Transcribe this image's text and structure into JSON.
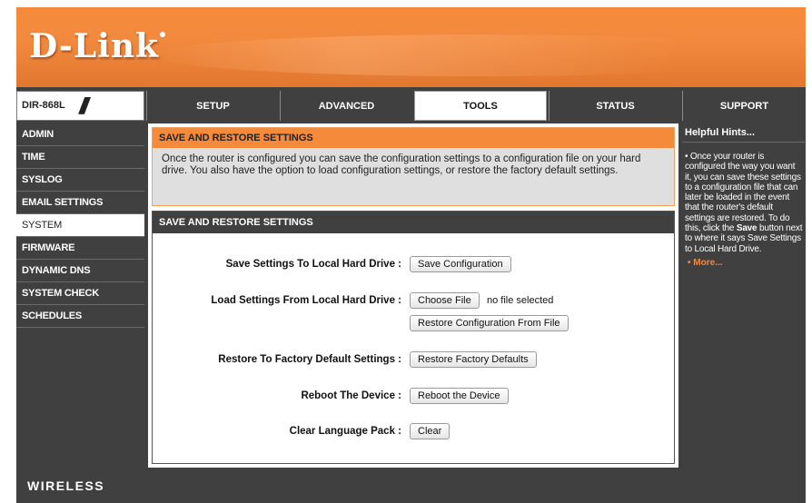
{
  "header": {
    "logo": "D-Link"
  },
  "topbar": {
    "model": "DIR-868L",
    "slash": "///",
    "tabs": [
      {
        "label": "SETUP"
      },
      {
        "label": "ADVANCED"
      },
      {
        "label": "TOOLS"
      },
      {
        "label": "STATUS"
      },
      {
        "label": "SUPPORT"
      }
    ]
  },
  "sidebar": {
    "items": [
      {
        "label": "ADMIN"
      },
      {
        "label": "TIME"
      },
      {
        "label": "SYSLOG"
      },
      {
        "label": "EMAIL SETTINGS"
      },
      {
        "label": "SYSTEM"
      },
      {
        "label": "FIRMWARE"
      },
      {
        "label": "DYNAMIC DNS"
      },
      {
        "label": "SYSTEM CHECK"
      },
      {
        "label": "SCHEDULES"
      }
    ]
  },
  "main": {
    "info_title": "SAVE AND RESTORE SETTINGS",
    "info_text": "Once the router is configured you can save the configuration settings to a configuration file on your hard drive. You also have the option to load configuration settings, or restore the factory default settings.",
    "settings_title": "SAVE AND RESTORE SETTINGS",
    "rows": {
      "save_label": "Save Settings To Local Hard Drive :",
      "save_button": "Save Configuration",
      "load_label": "Load Settings From Local Hard Drive :",
      "choose_button": "Choose File",
      "no_file": "no file selected",
      "restore_config_button": "Restore Configuration From File",
      "factory_label": "Restore To Factory Default Settings :",
      "factory_button": "Restore Factory Defaults",
      "reboot_label": "Reboot The Device :",
      "reboot_button": "Reboot the Device",
      "clear_label": "Clear Language Pack :",
      "clear_button": "Clear"
    }
  },
  "hints": {
    "title": "Helpful Hints...",
    "bullet": "•",
    "text_before": "Once your router is configured the way you want it, you can save these settings to a configuration file that can later be loaded in the event that the router's default settings are restored. To do this, click the",
    "text_bold": "Save",
    "text_after": "button next to where it says Save Settings to Local Hard Drive.",
    "more": "More..."
  },
  "footer": {
    "brand": "WIRELESS"
  },
  "colors": {
    "accent": "#f58a3a",
    "panel": "#404040"
  }
}
